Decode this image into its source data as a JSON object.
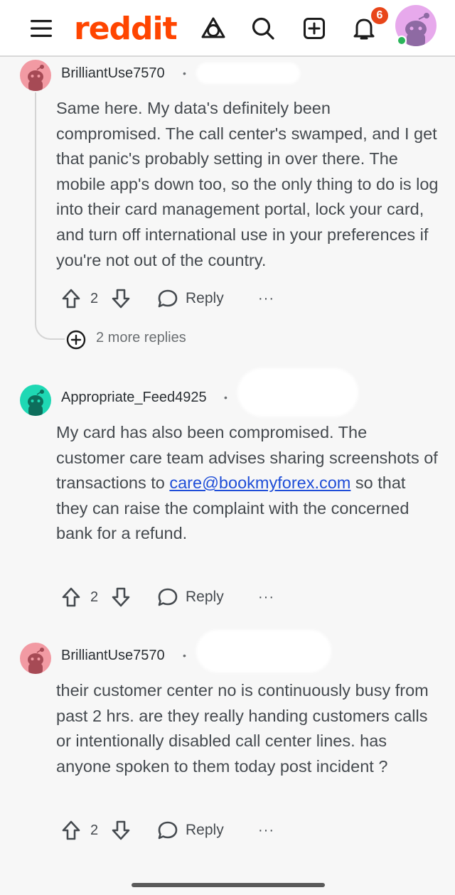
{
  "header": {
    "logo_text": "reddit",
    "notification_count": "6",
    "icons": [
      "menu-icon",
      "popular-icon",
      "search-icon",
      "create-icon",
      "bell-icon",
      "avatar"
    ],
    "brand_color": "#ff4500"
  },
  "comments": [
    {
      "username": "BrilliantUse7570",
      "separator": "•",
      "body": "Same here. My data's definitely been compromised. The call center's swamped, and I get that panic's probably setting in over there. The mobile app's down too, so the only thing to do is log into their card management portal, lock your card, and turn off international use in your preferences if you're not out of the country.",
      "votes": "2",
      "reply_label": "Reply",
      "more_label": "···",
      "avatar_color": "#f29aa3"
    },
    {
      "username": "Appropriate_Feed4925",
      "separator": "•",
      "body_before_link": "My card has also been compromised. The customer care team advises sharing screenshots of transactions to ",
      "link_text": "care@bookmyforex.com",
      "body_after_link": " so that they can raise the complaint with the concerned bank for a refund.",
      "votes": "2",
      "reply_label": "Reply",
      "more_label": "···",
      "avatar_color": "#1fd8b4"
    },
    {
      "username": "BrilliantUse7570",
      "separator": "•",
      "body": "their customer center no is continuously busy from past 2 hrs. are they really handing customers calls or intentionally disabled call center lines. has anyone spoken to them today post incident ?",
      "votes": "2",
      "reply_label": "Reply",
      "more_label": "···",
      "avatar_color": "#f29aa3"
    }
  ],
  "more_replies": {
    "label": "2 more replies"
  }
}
